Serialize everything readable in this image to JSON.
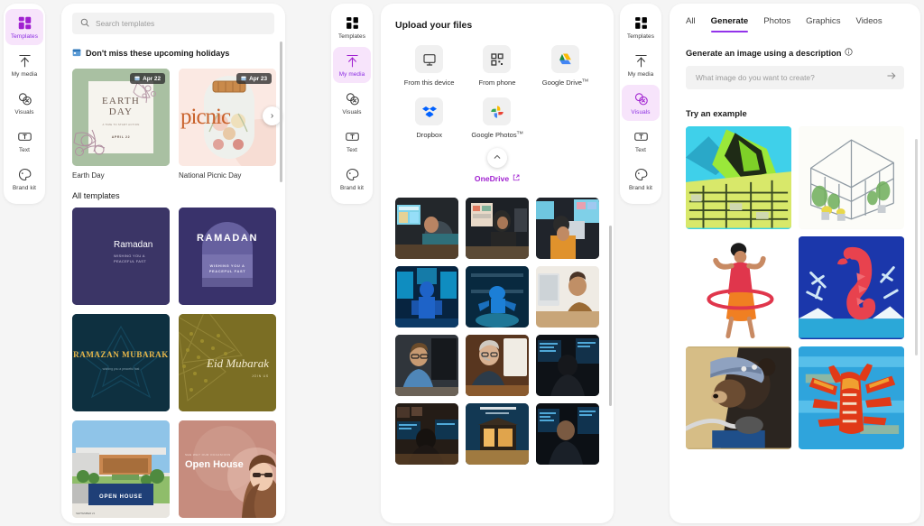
{
  "rails": {
    "items": [
      {
        "label": "Templates",
        "icon": "grid-icon"
      },
      {
        "label": "My media",
        "icon": "upload-arrow-icon"
      },
      {
        "label": "Visuals",
        "icon": "visuals-bubbles-icon"
      },
      {
        "label": "Text",
        "icon": "text-box-icon"
      },
      {
        "label": "Brand kit",
        "icon": "brand-palette-icon"
      }
    ],
    "active_left": "Templates",
    "active_middle": "My media",
    "active_right": "Visuals"
  },
  "templates_panel": {
    "search": {
      "placeholder": "Search templates",
      "icon": "search-icon"
    },
    "section_heading": "Don't miss these upcoming holidays",
    "section_icon": "calendar-icon",
    "next_arrow": "›",
    "holidays": [
      {
        "name": "Earth Day",
        "date_badge": "Apr 22",
        "title": "EARTH DAY",
        "subtitle": "A TIME TO START ACTION",
        "footer": "APRIL 22"
      },
      {
        "name": "National Picnic Day",
        "date_badge": "Apr 23",
        "title": "picnic",
        "subtitle": "",
        "footer": ""
      }
    ],
    "all_templates_label": "All templates",
    "templates": [
      {
        "name": "Ramadan crescent",
        "title": "Ramadan",
        "subtitle": "WISHING YOU A PEACEFUL FAST"
      },
      {
        "name": "Ramadan arch",
        "title": "RAMADAN",
        "subtitle": "WISHING YOU A PEACEFUL FAST"
      },
      {
        "name": "Ramazan Mubarak",
        "title": "RAMAZAN MUBARAK",
        "subtitle": "wishing you a peaceful fast"
      },
      {
        "name": "Eid Mubarak gold",
        "title": "Eid Mubarak",
        "subtitle": "JOIN US"
      },
      {
        "name": "Open House exterior",
        "title": "OPEN HOUSE",
        "subtitle": "SEPTEMBER 21"
      },
      {
        "name": "Open House portrait",
        "title": "Open House",
        "subtitle": "SEE WHY OUR OCCASIONS"
      }
    ]
  },
  "upload_panel": {
    "title": "Upload your files",
    "sources": [
      {
        "label": "From this device",
        "icon": "monitor-icon"
      },
      {
        "label": "From phone",
        "icon": "qr-code-icon"
      },
      {
        "label": "Google Drive",
        "sup": "TM",
        "icon": "google-drive-icon"
      },
      {
        "label": "Dropbox",
        "icon": "dropbox-icon"
      },
      {
        "label": "Google Photos",
        "sup": "TM",
        "icon": "google-photos-icon"
      }
    ],
    "collapse_icon": "chevron-up-icon",
    "onedrive": {
      "label": "OneDrive",
      "icon": "external-link-icon"
    },
    "photos": [
      "team at monitors",
      "person at whiteboard",
      "woman orange sweater desk",
      "blue robot screens",
      "blue robot arms",
      "man brown sweater imac",
      "man glasses blue shirt",
      "older man at screen",
      "man back dual monitors",
      "person back warm room",
      "cabin night render",
      "man side code screens"
    ]
  },
  "visuals_panel": {
    "tabs": [
      {
        "label": "All",
        "active": false
      },
      {
        "label": "Generate",
        "active": true
      },
      {
        "label": "Photos",
        "active": false
      },
      {
        "label": "Graphics",
        "active": false
      },
      {
        "label": "Videos",
        "active": false
      }
    ],
    "generate_label": "Generate an image using a description",
    "info_icon": "info-icon",
    "prompt_placeholder": "What image do you want to create?",
    "submit_icon": "arrow-right-icon",
    "try_label": "Try an example",
    "examples": [
      "machu picchu painting",
      "greenhouse sketch",
      "hula hoop figurine",
      "paper seahorse",
      "bear in helmet on motorcycle",
      "lobster painting"
    ]
  },
  "colors": {
    "accent_purple": "#a020d0",
    "tab_underline": "#9333ea",
    "active_pill_bg": "#f7e4fb",
    "page_bg": "#f5f5f5",
    "panel_bg": "#ffffff"
  }
}
